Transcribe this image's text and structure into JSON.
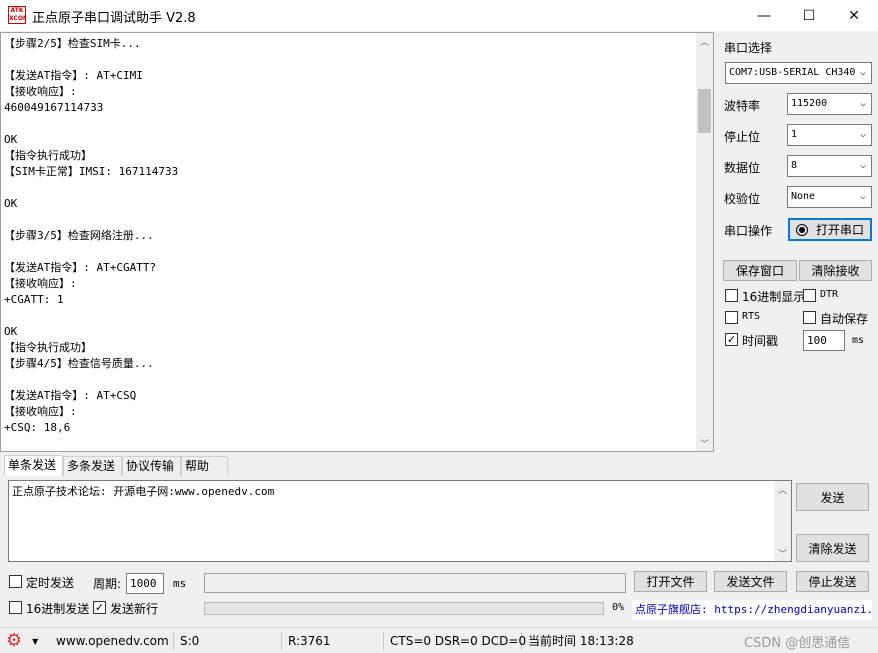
{
  "window": {
    "title": "正点原子串口调试助手 V2.8",
    "logo_text": "ATK\nXCOM",
    "minimize": "—",
    "maximize": "☐",
    "close": "✕"
  },
  "receive": {
    "lines": [
      "【步骤2/5】检查SIM卡...",
      "",
      "【发送AT指令】: AT+CIMI",
      "【接收响应】:",
      "460049167114733",
      "",
      "OK",
      "【指令执行成功】",
      "【SIM卡正常】IMSI: 167114733",
      "",
      "OK",
      "",
      "【步骤3/5】检查网络注册...",
      "",
      "【发送AT指令】: AT+CGATT?",
      "【接收响应】:",
      "+CGATT: 1",
      "",
      "OK",
      "【指令执行成功】",
      "【步骤4/5】检查信号质量...",
      "",
      "【发送AT指令】: AT+CSQ",
      "【接收响应】:",
      "+CSQ: 18,6"
    ]
  },
  "settings": {
    "port_select_label": "串口选择",
    "port_value": "COM7:USB-SERIAL CH340",
    "baud_label": "波特率",
    "baud_value": "115200",
    "stop_label": "停止位",
    "stop_value": "1",
    "data_label": "数据位",
    "data_value": "8",
    "parity_label": "校验位",
    "parity_value": "None",
    "port_op_label": "串口操作",
    "open_port_button": "打开串口",
    "save_window_button": "保存窗口",
    "clear_recv_button": "清除接收",
    "hex_display": "16进制显示",
    "dtr": "DTR",
    "rts": "RTS",
    "auto_save": "自动保存",
    "timestamp": "时间戳",
    "timestamp_value": "100",
    "ms_unit": "ms",
    "check_mark": "✓"
  },
  "tabs": [
    "单条发送",
    "多条发送",
    "协议传输",
    "帮助"
  ],
  "send": {
    "text": "正点原子技术论坛: 开源电子网:www.openedv.com",
    "send_button": "发送",
    "clear_send_button": "清除发送",
    "timed_send": "定时发送",
    "period_label": "周期:",
    "period_value": "1000",
    "period_unit": "ms",
    "hex_send": "16进制发送",
    "send_newline": "发送新行",
    "open_file_button": "打开文件",
    "send_file_button": "发送文件",
    "stop_send_button": "停止发送",
    "progress_percent": "0%",
    "progress_value": 0,
    "store_link": "点原子旗舰店: https://zhengdianyuanzi."
  },
  "status": {
    "url": "www.openedv.com",
    "sent": "S:0",
    "received": "R:3761",
    "signals": "CTS=0 DSR=0 DCD=0",
    "time": "当前时间 18:13:28",
    "watermark": "CSDN @创思通信"
  }
}
